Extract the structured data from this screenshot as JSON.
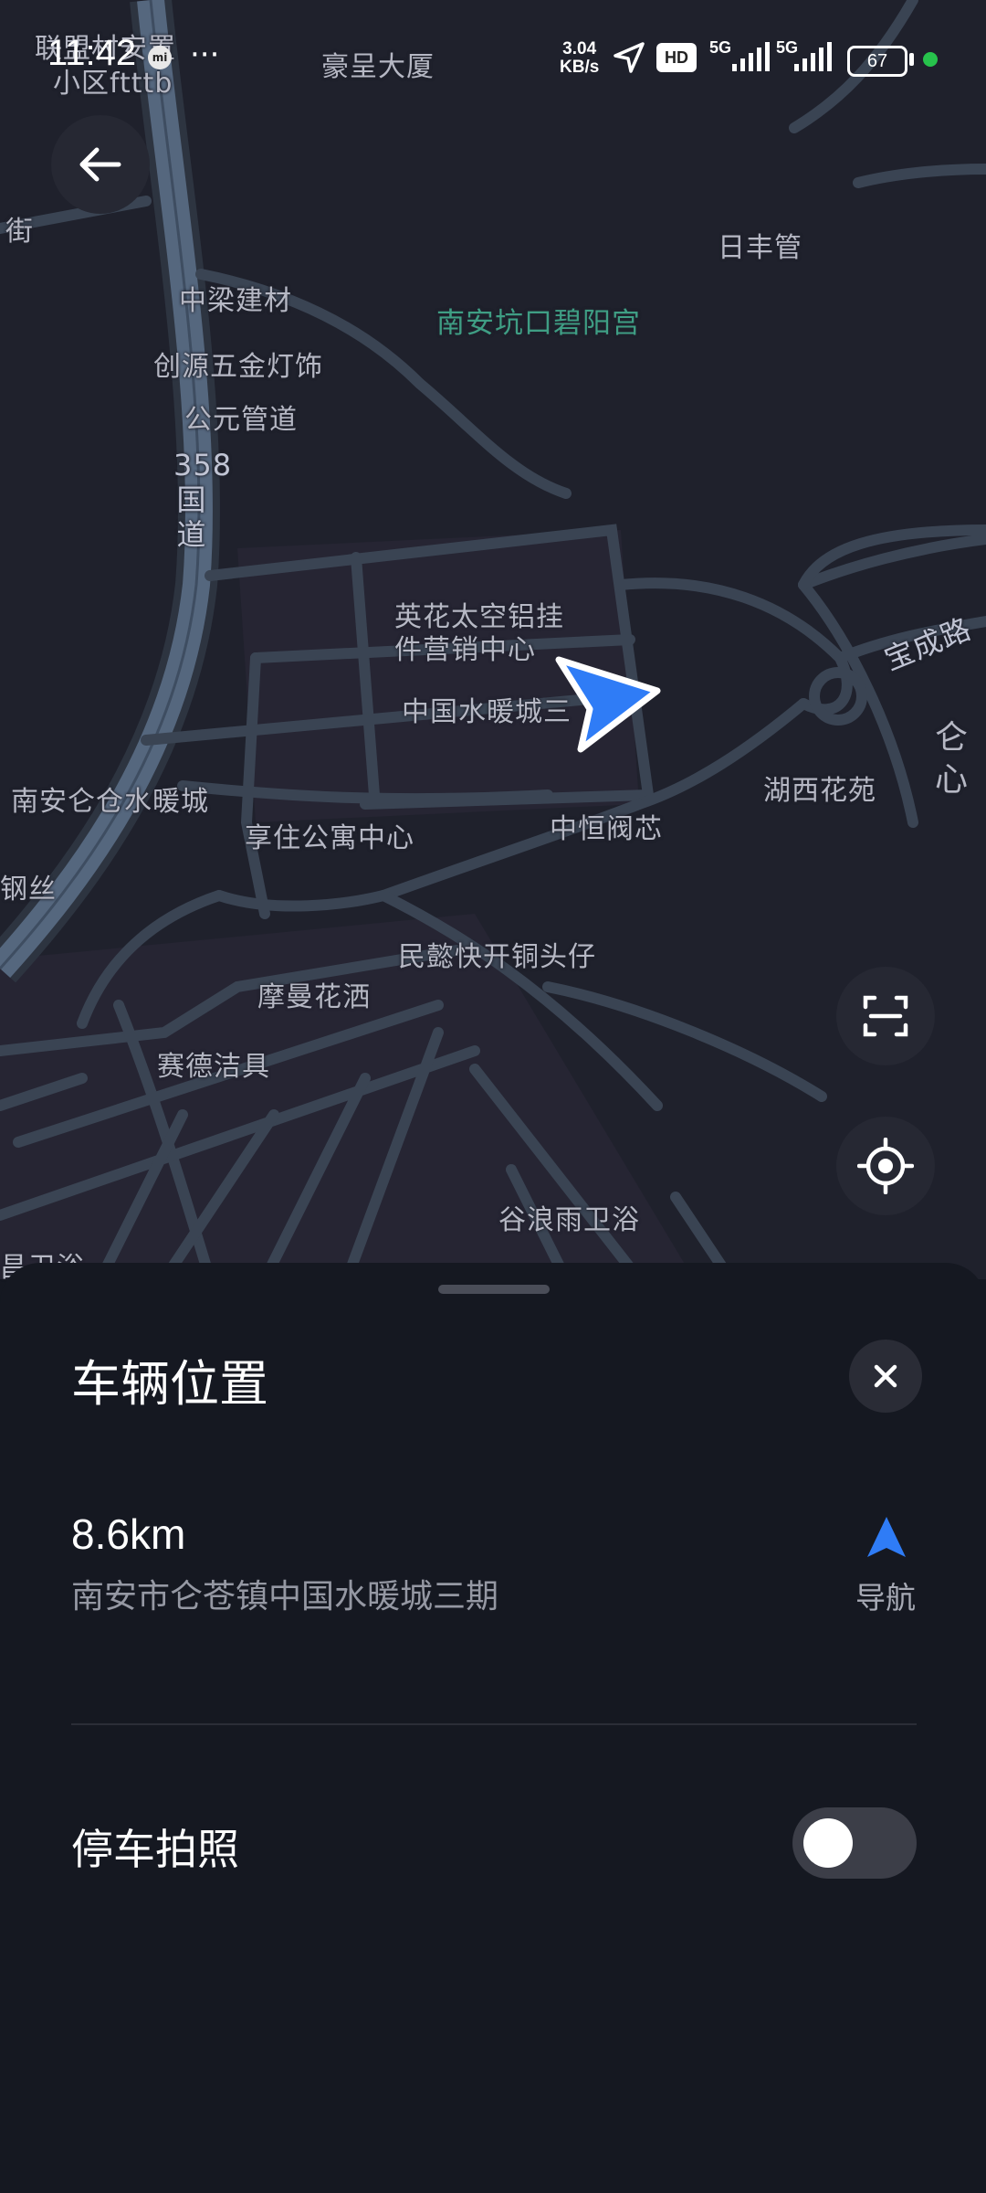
{
  "status_bar": {
    "time": "11:42",
    "mi_badge": "mi",
    "more": "···",
    "speed_value": "3.04",
    "speed_unit": "KB/s",
    "hd": "HD",
    "network_1": "5G",
    "network_2": "5G",
    "battery": "67"
  },
  "map": {
    "labels": {
      "place_1": "联盟村安置",
      "place_1b": "小区ftttb",
      "place_2": "豪呈大厦",
      "street_left": "街",
      "place_3": "日丰管",
      "place_4": "中梁建材",
      "place_5": "南安坑口碧阳宫",
      "place_6": "创源五金灯饰",
      "place_7": "公元管道",
      "highway": "358国道",
      "place_8": "英花太空铝挂",
      "place_8b": "件营销中心",
      "road_1": "宝成路",
      "place_9": "中国水暖城三",
      "place_10": "仑",
      "place_10b": "心",
      "place_11": "南安仑仓水暖城",
      "place_12": "湖西花苑",
      "place_13": "享住公寓中心",
      "place_14": "中恒阀芯",
      "place_15": "钢丝",
      "place_16": "民懿快开铜头仔",
      "place_17": "摩曼花洒",
      "place_18": "赛德洁具",
      "place_19": "谷浪雨卫浴",
      "place_20": "昌卫浴"
    }
  },
  "sheet": {
    "title": "车辆位置",
    "distance": "8.6km",
    "address": "南安市仑苍镇中国水暖城三期",
    "nav_label": "导航",
    "photo_label": "停车拍照",
    "photo_toggle_on": false
  },
  "colors": {
    "accent": "#2f7cf6",
    "map_bg": "#1f212c",
    "road": "#3a4453",
    "highway": "#55677e",
    "sheet_bg": "#151821"
  }
}
